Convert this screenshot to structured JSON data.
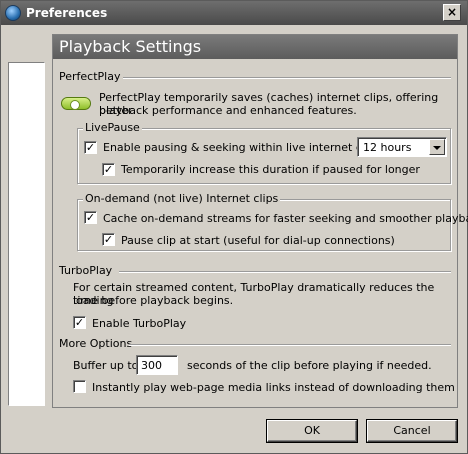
{
  "window": {
    "title": "Preferences",
    "close_glyph": "×"
  },
  "header": {
    "title": "Playback Settings"
  },
  "perfectplay": {
    "section_label": "PerfectPlay",
    "description_line1": "PerfectPlay temporarily saves (caches) internet clips, offering better",
    "description_line2": "playback performance and enhanced features.",
    "icon": "toggle-switch-icon",
    "livepause": {
      "group_label": "LivePause",
      "enable_label": "Enable pausing & seeking within live internet clips for",
      "enable_checked": true,
      "duration_value": "12 hours",
      "increase_label": "Temporarily increase this duration if paused for longer",
      "increase_checked": true
    },
    "ondemand": {
      "group_label": "On-demand (not live) Internet clips",
      "cache_label": "Cache on-demand streams for faster seeking and smoother playback",
      "cache_checked": true,
      "pause_label": "Pause clip at start (useful for dial-up connections)",
      "pause_checked": true
    }
  },
  "turboplay": {
    "section_label": "TurboPlay",
    "description_line1": "For certain streamed content, TurboPlay dramatically reduces the loading",
    "description_line2": "time before playback begins.",
    "enable_label": "Enable TurboPlay",
    "enable_checked": true
  },
  "more_options": {
    "section_label": "More Options",
    "buffer_prefix": "Buffer up to",
    "buffer_value": "300",
    "buffer_suffix": "seconds of the clip before playing if needed.",
    "instant_label": "Instantly play web-page media links instead of downloading them",
    "instant_checked": false
  },
  "buttons": {
    "ok": "OK",
    "cancel": "Cancel"
  },
  "colors": {
    "title_bar": "#5c5c5c",
    "face": "#d4d0c8",
    "accent_icon": "#8fbf2a"
  }
}
